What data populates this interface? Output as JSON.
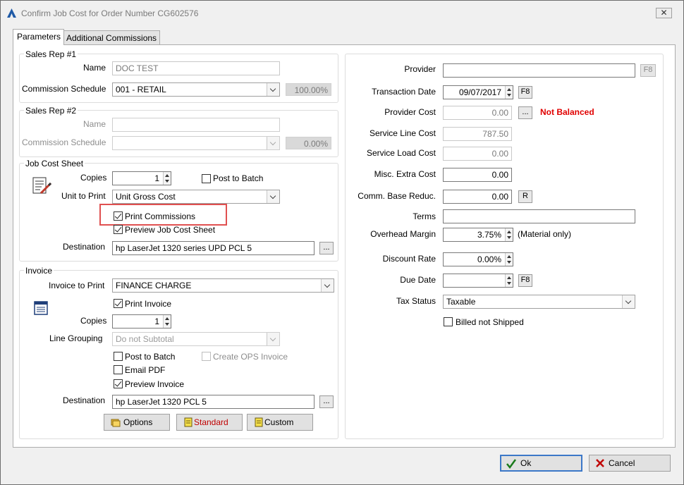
{
  "window": {
    "title": "Confirm Job Cost for Order Number CG602576",
    "close_label": "✕"
  },
  "tabs": [
    {
      "label": "Parameters",
      "active": true
    },
    {
      "label": "Additional Commissions",
      "active": false
    }
  ],
  "sales_rep_1": {
    "title": "Sales Rep #1",
    "name_label": "Name",
    "name_value": "DOC TEST",
    "schedule_label": "Commission Schedule",
    "schedule_value": "001 - RETAIL",
    "schedule_pct": "100.00%"
  },
  "sales_rep_2": {
    "title": "Sales Rep #2",
    "name_label": "Name",
    "name_value": "",
    "schedule_label": "Commission Schedule",
    "schedule_value": "",
    "schedule_pct": "0.00%"
  },
  "job_cost_sheet": {
    "title": "Job Cost Sheet",
    "copies_label": "Copies",
    "copies_value": "1",
    "post_to_batch_label": "Post to Batch",
    "post_to_batch_checked": false,
    "unit_label": "Unit to Print",
    "unit_value": "Unit Gross Cost",
    "print_commissions_label": "Print Commissions",
    "print_commissions_checked": true,
    "preview_label": "Preview Job Cost Sheet",
    "preview_checked": true,
    "destination_label": "Destination",
    "destination_value": "hp LaserJet 1320 series UPD PCL 5",
    "browse_label": "..."
  },
  "invoice": {
    "title": "Invoice",
    "invoice_to_print_label": "Invoice to Print",
    "invoice_to_print_value": "FINANCE CHARGE",
    "print_invoice_label": "Print Invoice",
    "print_invoice_checked": true,
    "copies_label": "Copies",
    "copies_value": "1",
    "line_grouping_label": "Line Grouping",
    "line_grouping_value": "Do not Subtotal",
    "post_to_batch_label": "Post to Batch",
    "post_to_batch_checked": false,
    "create_ops_label": "Create OPS Invoice",
    "create_ops_checked": false,
    "email_pdf_label": "Email PDF",
    "email_pdf_checked": false,
    "preview_label": "Preview Invoice",
    "preview_checked": true,
    "destination_label": "Destination",
    "destination_value": "hp LaserJet 1320 PCL 5",
    "browse_label": "..."
  },
  "buttons": {
    "options": "Options",
    "standard": "Standard",
    "custom": "Custom",
    "ok": "Ok",
    "cancel": "Cancel"
  },
  "right": {
    "provider_label": "Provider",
    "provider_value": "",
    "provider_key": "F8",
    "transaction_date_label": "Transaction Date",
    "transaction_date_value": "09/07/2017",
    "transaction_date_key": "F8",
    "provider_cost_label": "Provider Cost",
    "provider_cost_value": "0.00",
    "provider_cost_btn": "...",
    "not_balanced": "Not Balanced",
    "service_line_cost_label": "Service Line Cost",
    "service_line_cost_value": "787.50",
    "service_load_cost_label": "Service Load Cost",
    "service_load_cost_value": "0.00",
    "misc_extra_cost_label": "Misc. Extra Cost",
    "misc_extra_cost_value": "0.00",
    "comm_base_label": "Comm. Base Reduc.",
    "comm_base_value": "0.00",
    "comm_base_btn": "R",
    "terms_label": "Terms",
    "terms_value": "",
    "overhead_label": "Overhead Margin",
    "overhead_value": "3.75%",
    "overhead_note": "(Material only)",
    "discount_label": "Discount Rate",
    "discount_value": "0.00%",
    "due_date_label": "Due Date",
    "due_date_value": "",
    "due_date_key": "F8",
    "tax_status_label": "Tax Status",
    "tax_status_value": "Taxable",
    "billed_label": "Billed not Shipped",
    "billed_checked": false
  },
  "colors": {
    "highlight": "#e05050",
    "warning_text": "#e00000",
    "ok_check": "#1a7a1a",
    "cancel_x": "#c00000"
  }
}
